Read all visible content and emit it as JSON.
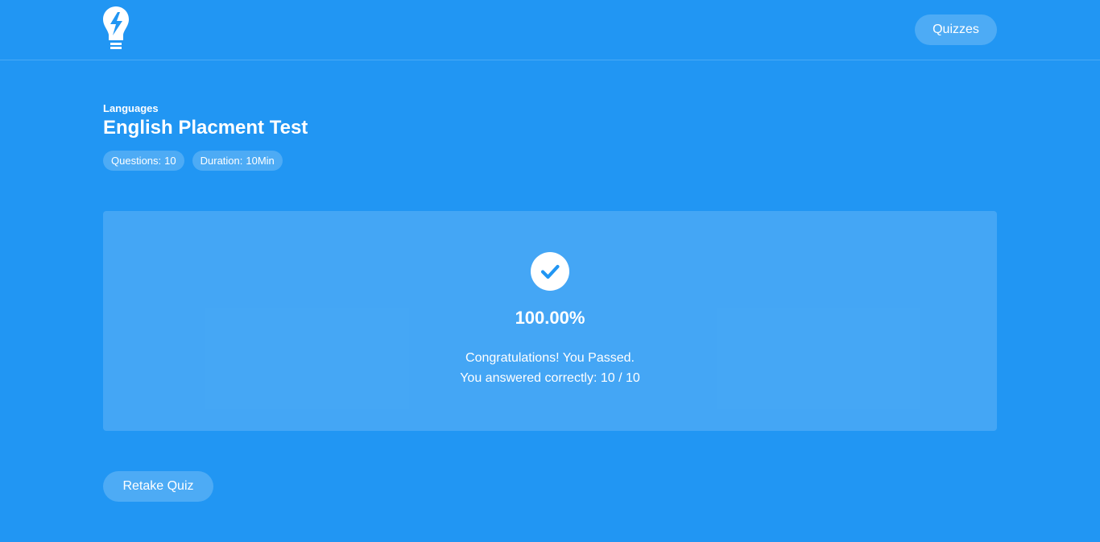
{
  "header": {
    "logo_icon": "lightbulb-bolt-icon",
    "nav_quizzes_label": "Quizzes"
  },
  "quiz": {
    "category": "Languages",
    "title": "English Placment Test",
    "questions_label": "Questions:",
    "questions_value": "10",
    "duration_label": "Duration:",
    "duration_value": "10Min"
  },
  "result": {
    "status_icon": "check-circle-icon",
    "score": "100.00%",
    "message": "Congratulations! You Passed.",
    "answered_label": "You answered correctly:",
    "answered_value": "10 / 10"
  },
  "actions": {
    "retake_label": "Retake Quiz"
  },
  "colors": {
    "background": "#2196f3",
    "check": "#2196f3",
    "text": "#ffffff"
  }
}
